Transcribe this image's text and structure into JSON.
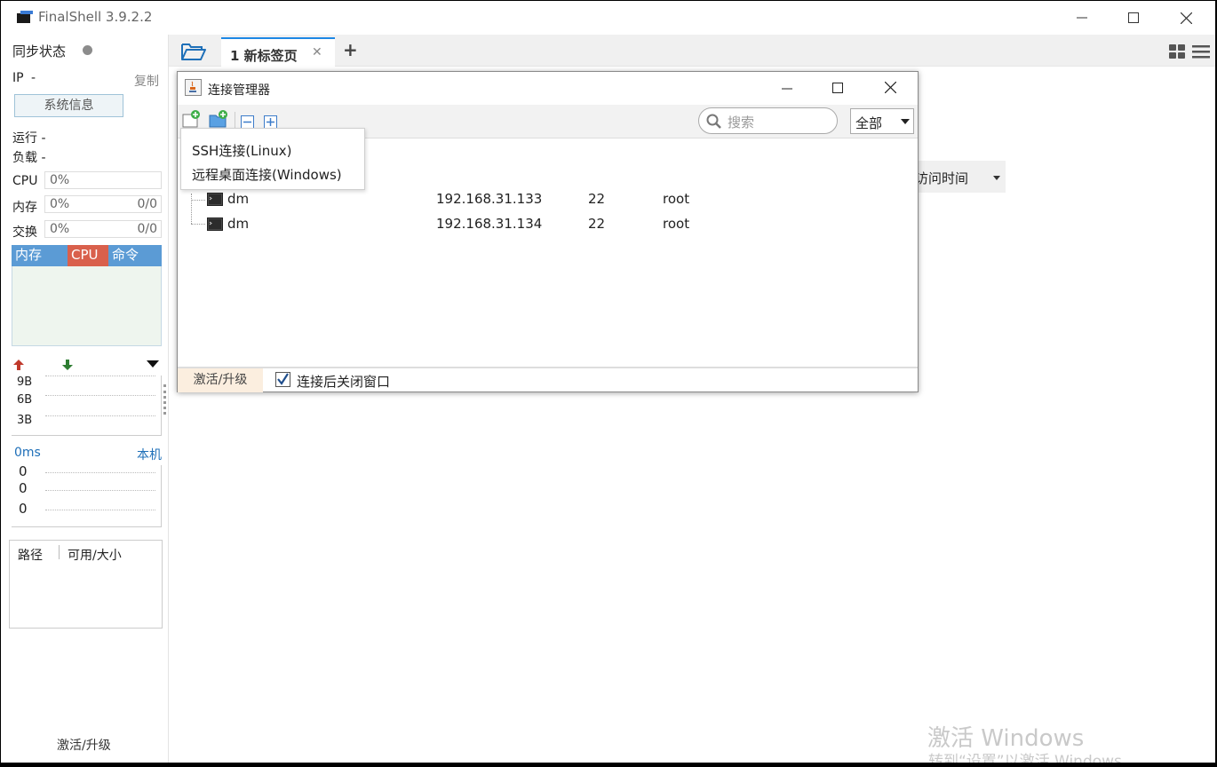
{
  "window": {
    "title": "FinalShell 3.9.2.2"
  },
  "sidebar": {
    "sync_label": "同步状态",
    "ip_label": "IP",
    "ip_value": "-",
    "copy_label": "复制",
    "sysinfo_button": "系统信息",
    "run_label": "运行 -",
    "load_label": "负载 -",
    "cpu": {
      "label": "CPU",
      "value": "0%"
    },
    "mem": {
      "label": "内存",
      "value": "0%",
      "detail": "0/0"
    },
    "swap": {
      "label": "交换",
      "value": "0%",
      "detail": "0/0"
    },
    "tabs": {
      "mem": "内存",
      "cpu": "CPU",
      "cmd": "命令"
    },
    "net_scale": [
      "9B",
      "6B",
      "3B"
    ],
    "ping": {
      "latency": "0ms",
      "host": "本机",
      "values": [
        "0",
        "0",
        "0"
      ]
    },
    "disk_headers": {
      "path": "路径",
      "size": "可用/大小"
    },
    "activate": "激活/升级"
  },
  "main": {
    "tab_label": "1 新标签页",
    "sort_label": "访问时间"
  },
  "dialog": {
    "title": "连接管理器",
    "search_placeholder": "搜索",
    "filter_value": "全部",
    "connections": [
      {
        "name": "dm",
        "host": "192.168.31.133",
        "port": "22",
        "user": "root"
      },
      {
        "name": "dm",
        "host": "192.168.31.134",
        "port": "22",
        "user": "root"
      }
    ],
    "footer_activate": "激活/升级",
    "close_after_connect": "连接后关闭窗口",
    "close_after_connect_checked": true
  },
  "popup_menu": {
    "ssh": "SSH连接(Linux)",
    "rdp": "远程桌面连接(Windows)"
  },
  "os_watermark": {
    "line1": "激活 Windows",
    "line2": "转到“设置”以激活 Windows。"
  },
  "colors": {
    "accent": "#1e88e5",
    "mem_tab": "#5b9bd5",
    "cpu_tab": "#d9604c",
    "cmd_tab": "#5b9bd5"
  }
}
